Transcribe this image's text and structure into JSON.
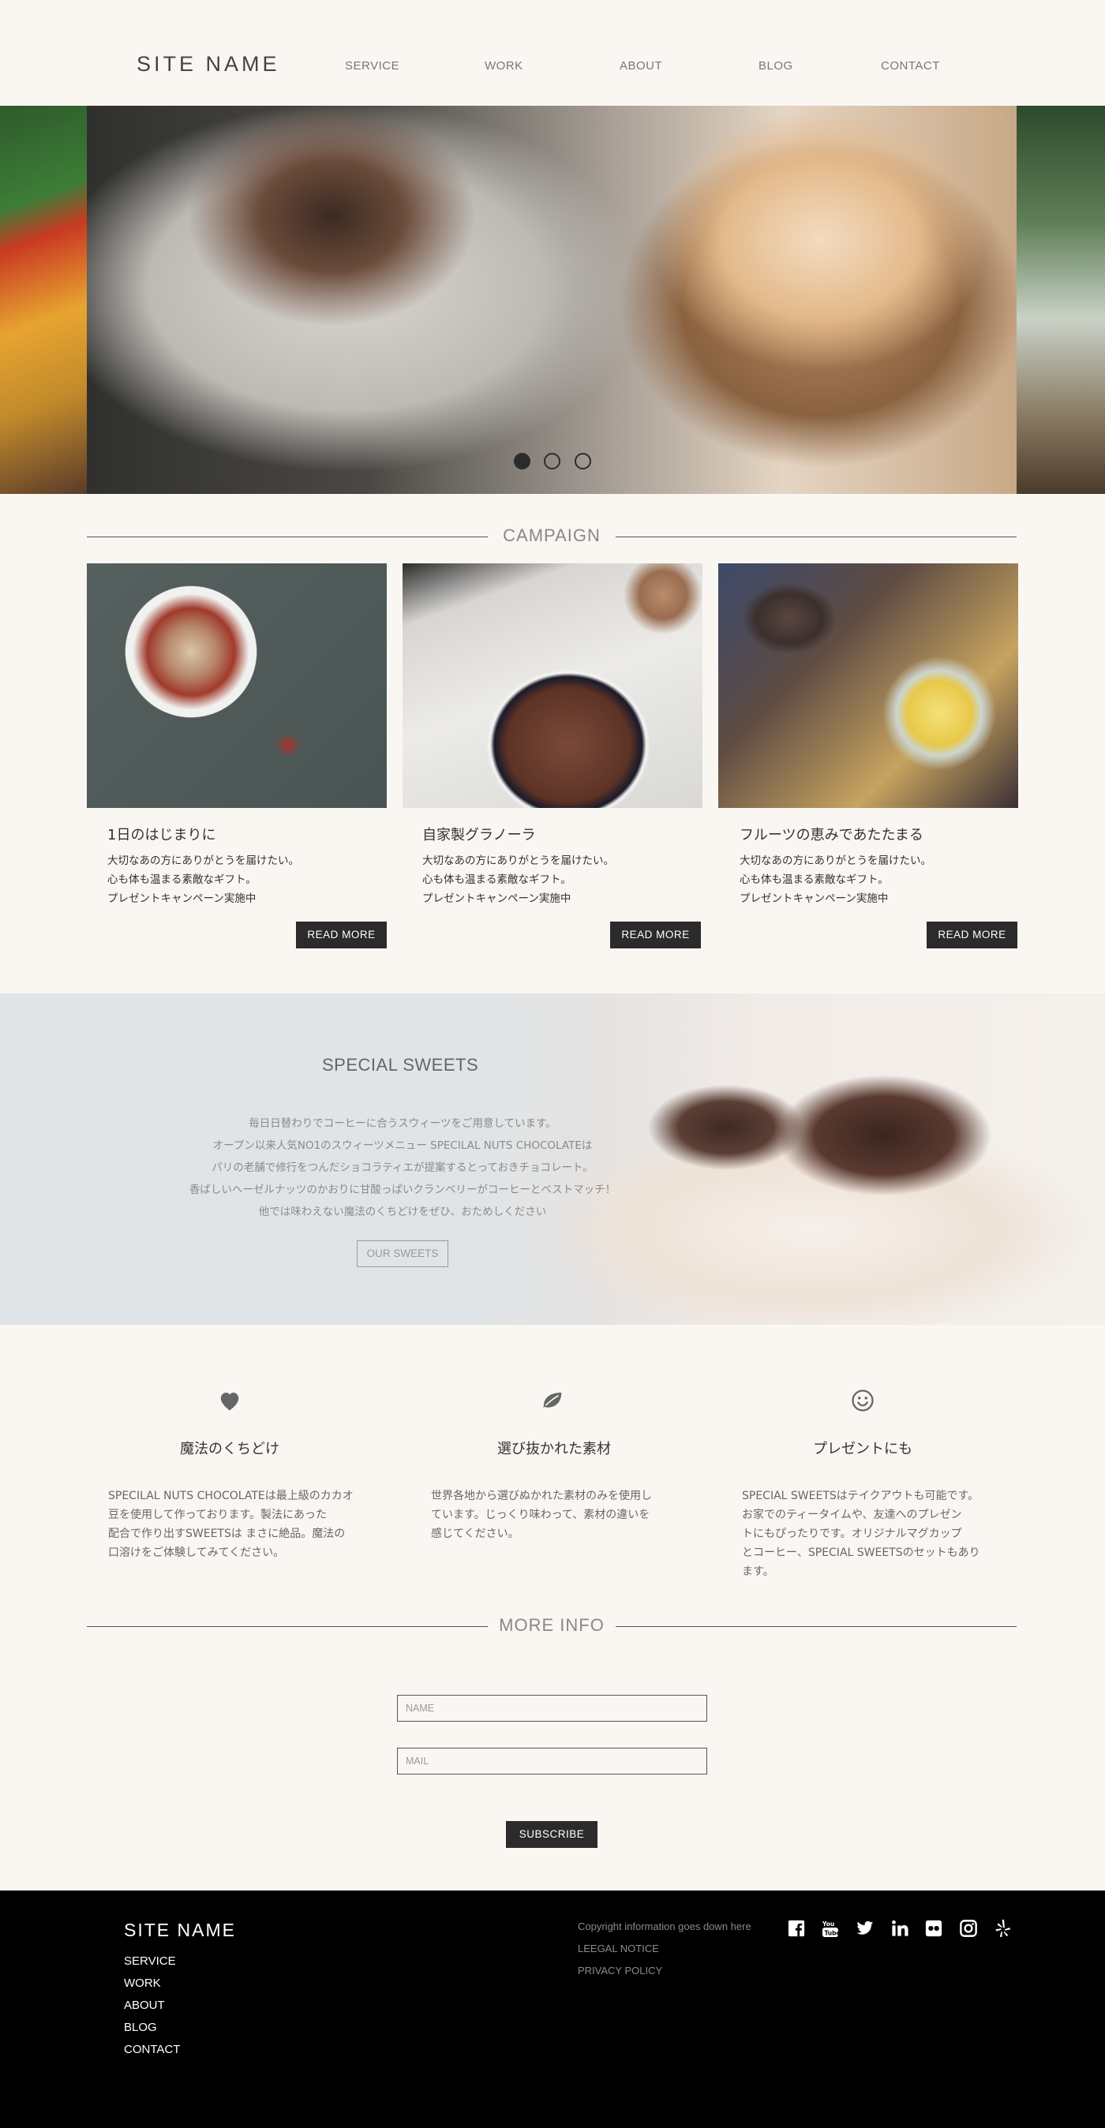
{
  "header": {
    "site_name": "SITE NAME",
    "nav": [
      "SERVICE",
      "WORK",
      "ABOUT",
      "BLOG",
      "CONTACT"
    ]
  },
  "hero": {
    "slide_count": 3,
    "active_slide": 1
  },
  "campaign": {
    "title": "CAMPAIGN",
    "cards": [
      {
        "title": "1日のはじまりに",
        "lines": [
          "大切なあの方にありがとうを届けたい。",
          "心も体も温まる素敵なギフト。",
          "プレゼントキャンペーン実施中"
        ],
        "button": "READ MORE"
      },
      {
        "title": "自家製グラノーラ",
        "lines": [
          "大切なあの方にありがとうを届けたい。",
          "心も体も温まる素敵なギフト。",
          "プレゼントキャンペーン実施中"
        ],
        "button": "READ MORE"
      },
      {
        "title": "フルーツの恵みであたたまる",
        "lines": [
          "大切なあの方にありがとうを届けたい。",
          "心も体も温まる素敵なギフト。",
          "プレゼントキャンペーン実施中"
        ],
        "button": "READ MORE"
      }
    ]
  },
  "sweets": {
    "title": "SPECIAL SWEETS",
    "lines": [
      "毎日日替わりでコーヒーに合うスウィーツをご用意しています。",
      "オープン以来人気NO1のスウィーツメニュー SPECILAL NUTS  CHOCOLATEは",
      "パリの老舗で修行をつんだショコラティエが提案するとっておきチョコレート。",
      "香ばしいヘーゼルナッツのかおりに甘酸っぱいクランベリーがコーヒーとベストマッチ！",
      "他では味わえない魔法のくちどけをぜひ、おためしください"
    ],
    "button": "OUR SWEETS"
  },
  "features": [
    {
      "icon": "heart-icon",
      "title": "魔法のくちどけ",
      "lines": [
        "SPECILAL NUTS  CHOCOLATEは最上級のカカオ",
        "豆を使用して作っております。製法にあった",
        "配合で作り出すSWEETSは まさに絶品。魔法の",
        "口溶けをご体験してみてください。"
      ]
    },
    {
      "icon": "leaf-icon",
      "title": "選び抜かれた素材",
      "lines": [
        "世界各地から選びぬかれた素材のみを使用し",
        "ています。じっくり味わって、素材の違いを",
        "感じてください。"
      ]
    },
    {
      "icon": "smiley-icon",
      "title": "プレゼントにも",
      "lines": [
        "SPECIAL SWEETSはテイクアウトも可能です。",
        "お家でのティータイムや、友達へのプレゼン",
        "トにもぴったりです。オリジナルマグカップ",
        "とコーヒー、SPECIAL SWEETSのセットもあり",
        "ます。"
      ]
    }
  ],
  "more_info": {
    "title": "MORE INFO",
    "name_placeholder": "NAME",
    "mail_placeholder": "MAIL",
    "subscribe": "SUBSCRIBE"
  },
  "footer": {
    "site_name": "SITE NAME",
    "links": [
      "SERVICE",
      "WORK",
      "ABOUT",
      "BLOG",
      "CONTACT"
    ],
    "copyright": "Copyright information goes down here",
    "legal": "LEEGAL NOTICE",
    "privacy": "PRIVACY POLICY",
    "social": [
      "facebook-icon",
      "youtube-icon",
      "twitter-icon",
      "linkedin-icon",
      "flickr-icon",
      "instagram-icon",
      "yelp-icon"
    ]
  }
}
